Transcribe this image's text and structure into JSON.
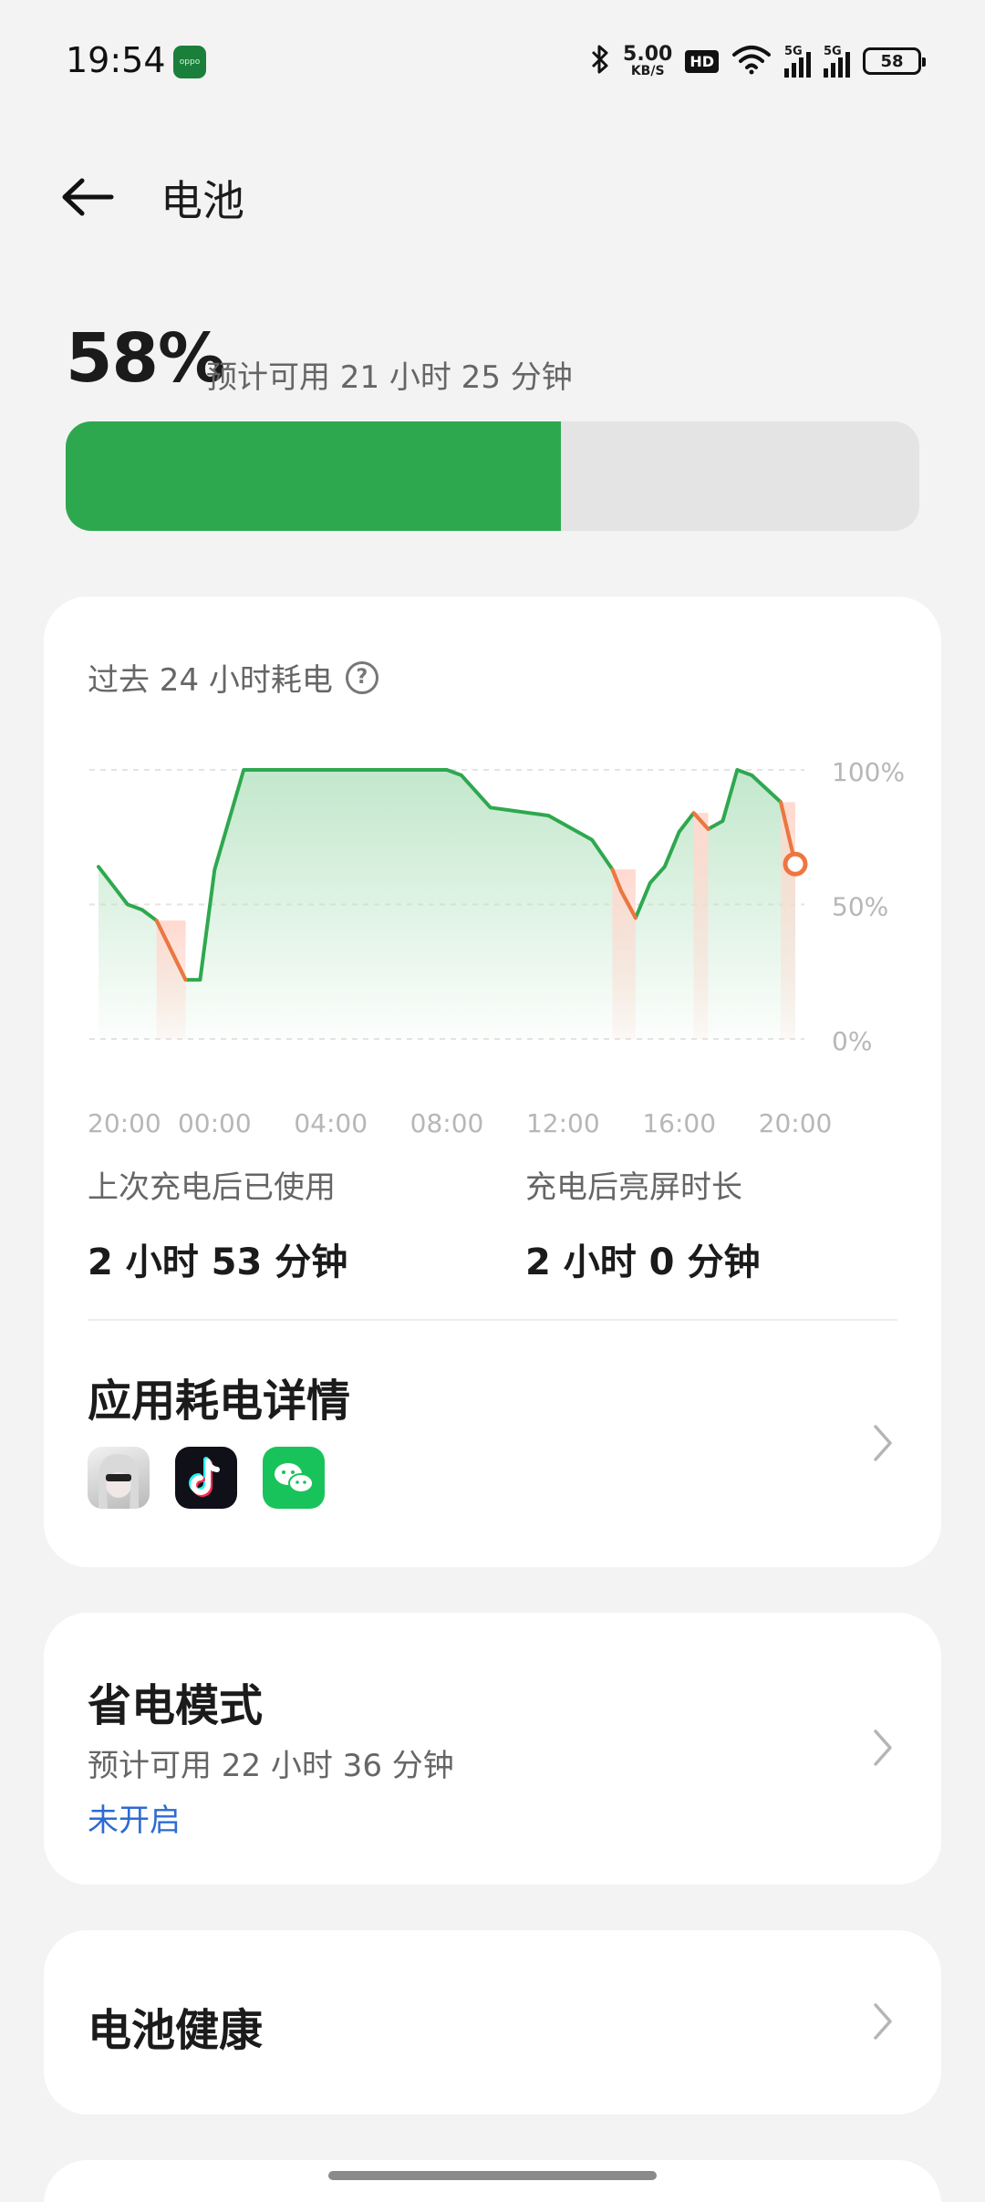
{
  "status_bar": {
    "time": "19:54",
    "app_badge": "oppo",
    "net_speed_value": "5.00",
    "net_speed_unit": "KB/S",
    "hd_label": "HD",
    "signal_1_label": "5G",
    "signal_2_label": "5G",
    "battery_percent": "58"
  },
  "header": {
    "title": "电池"
  },
  "battery": {
    "percent_text": "58%",
    "level": 0.58,
    "estimate": "预计可用 21 小时 25 分钟"
  },
  "usage_card": {
    "chart_title": "过去 24 小时耗电",
    "help_glyph": "?"
  },
  "chart_data": {
    "type": "area",
    "title": "过去 24 小时耗电",
    "x_tick_labels": [
      "20:00",
      "00:00",
      "04:00",
      "08:00",
      "12:00",
      "16:00",
      "20:00"
    ],
    "y_tick_labels": [
      "100%",
      "50%",
      "0%"
    ],
    "ylim": [
      0,
      100
    ],
    "xlim_hours": [
      0,
      24
    ],
    "grid": true,
    "points": [
      {
        "h": 0.0,
        "v": 64
      },
      {
        "h": 1.0,
        "v": 50
      },
      {
        "h": 1.5,
        "v": 48
      },
      {
        "h": 2.0,
        "v": 44
      },
      {
        "h": 3.0,
        "v": 22
      },
      {
        "h": 3.5,
        "v": 22
      },
      {
        "h": 4.0,
        "v": 63
      },
      {
        "h": 5.0,
        "v": 100
      },
      {
        "h": 12.0,
        "v": 100
      },
      {
        "h": 12.5,
        "v": 98
      },
      {
        "h": 13.5,
        "v": 86
      },
      {
        "h": 15.5,
        "v": 83
      },
      {
        "h": 16.5,
        "v": 77
      },
      {
        "h": 17.0,
        "v": 74
      },
      {
        "h": 17.7,
        "v": 63
      },
      {
        "h": 18.0,
        "v": 55
      },
      {
        "h": 18.5,
        "v": 45
      },
      {
        "h": 19.0,
        "v": 58
      },
      {
        "h": 19.5,
        "v": 64
      },
      {
        "h": 20.0,
        "v": 77
      },
      {
        "h": 20.5,
        "v": 84
      },
      {
        "h": 21.0,
        "v": 78
      },
      {
        "h": 21.5,
        "v": 81
      },
      {
        "h": 22.0,
        "v": 100
      },
      {
        "h": 22.5,
        "v": 98
      },
      {
        "h": 23.0,
        "v": 93
      },
      {
        "h": 23.5,
        "v": 88
      },
      {
        "h": 24.0,
        "v": 65
      }
    ],
    "drain_highlights": [
      {
        "from_h": 2.0,
        "to_h": 3.0
      },
      {
        "from_h": 17.7,
        "to_h": 18.5
      },
      {
        "from_h": 20.5,
        "to_h": 21.0
      },
      {
        "from_h": 23.5,
        "to_h": 24.0
      }
    ],
    "colors": {
      "line": "#2ea84f",
      "drain_line": "#ef7540",
      "area_top": "#bfe6c9",
      "highlight": "#ffd9cf",
      "grid": "#e3e3e3",
      "tick_text": "#b7b7b7"
    }
  },
  "stats": {
    "since_charge_label": "上次充电后已使用",
    "since_charge_value": "2 小时 53 分钟",
    "screen_on_label": "充电后亮屏时长",
    "screen_on_value": "2 小时 0 分钟"
  },
  "app_usage": {
    "title": "应用耗电详情",
    "apps": [
      {
        "name": "game-app-icon"
      },
      {
        "name": "douyin-app-icon"
      },
      {
        "name": "wechat-app-icon"
      }
    ]
  },
  "power_saving": {
    "title": "省电模式",
    "estimate": "预计可用 22 小时 36 分钟",
    "status": "未开启"
  },
  "battery_health": {
    "title": "电池健康"
  },
  "theme": {
    "green": "#2ea84f",
    "link_blue": "#2c6bd1"
  }
}
